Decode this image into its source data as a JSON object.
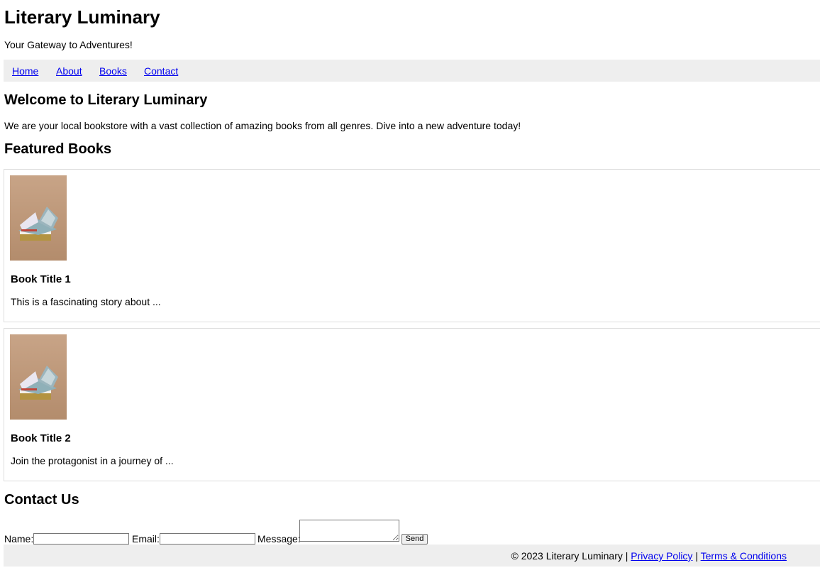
{
  "header": {
    "title": "Literary Luminary",
    "tagline": "Your Gateway to Adventures!"
  },
  "nav": {
    "items": [
      {
        "label": "Home"
      },
      {
        "label": "About"
      },
      {
        "label": "Books"
      },
      {
        "label": "Contact"
      }
    ]
  },
  "welcome": {
    "heading": "Welcome to Literary Luminary",
    "text": "We are your local bookstore with a vast collection of amazing books from all genres. Dive into a new adventure today!"
  },
  "featured": {
    "heading": "Featured Books",
    "books": [
      {
        "title": "Book Title 1",
        "description": "This is a fascinating story about ...",
        "cover_icon": "open-book-image"
      },
      {
        "title": "Book Title 2",
        "description": "Join the protagonist in a journey of ...",
        "cover_icon": "open-book-image"
      }
    ]
  },
  "contact": {
    "heading": "Contact Us",
    "name_label": "Name:",
    "name_value": "",
    "email_label": "Email:",
    "email_value": "",
    "message_label": "Message:",
    "message_value": "",
    "send_label": "Send"
  },
  "footer": {
    "copyright": "© 2023 Literary Luminary |",
    "separator": "|",
    "privacy_label": "Privacy Policy",
    "terms_label": "Terms & Conditions"
  },
  "colors": {
    "link": "#0000ee",
    "bar_background": "#eeeeee",
    "card_border": "#dddddd",
    "cover_background": "#c09a7c"
  }
}
